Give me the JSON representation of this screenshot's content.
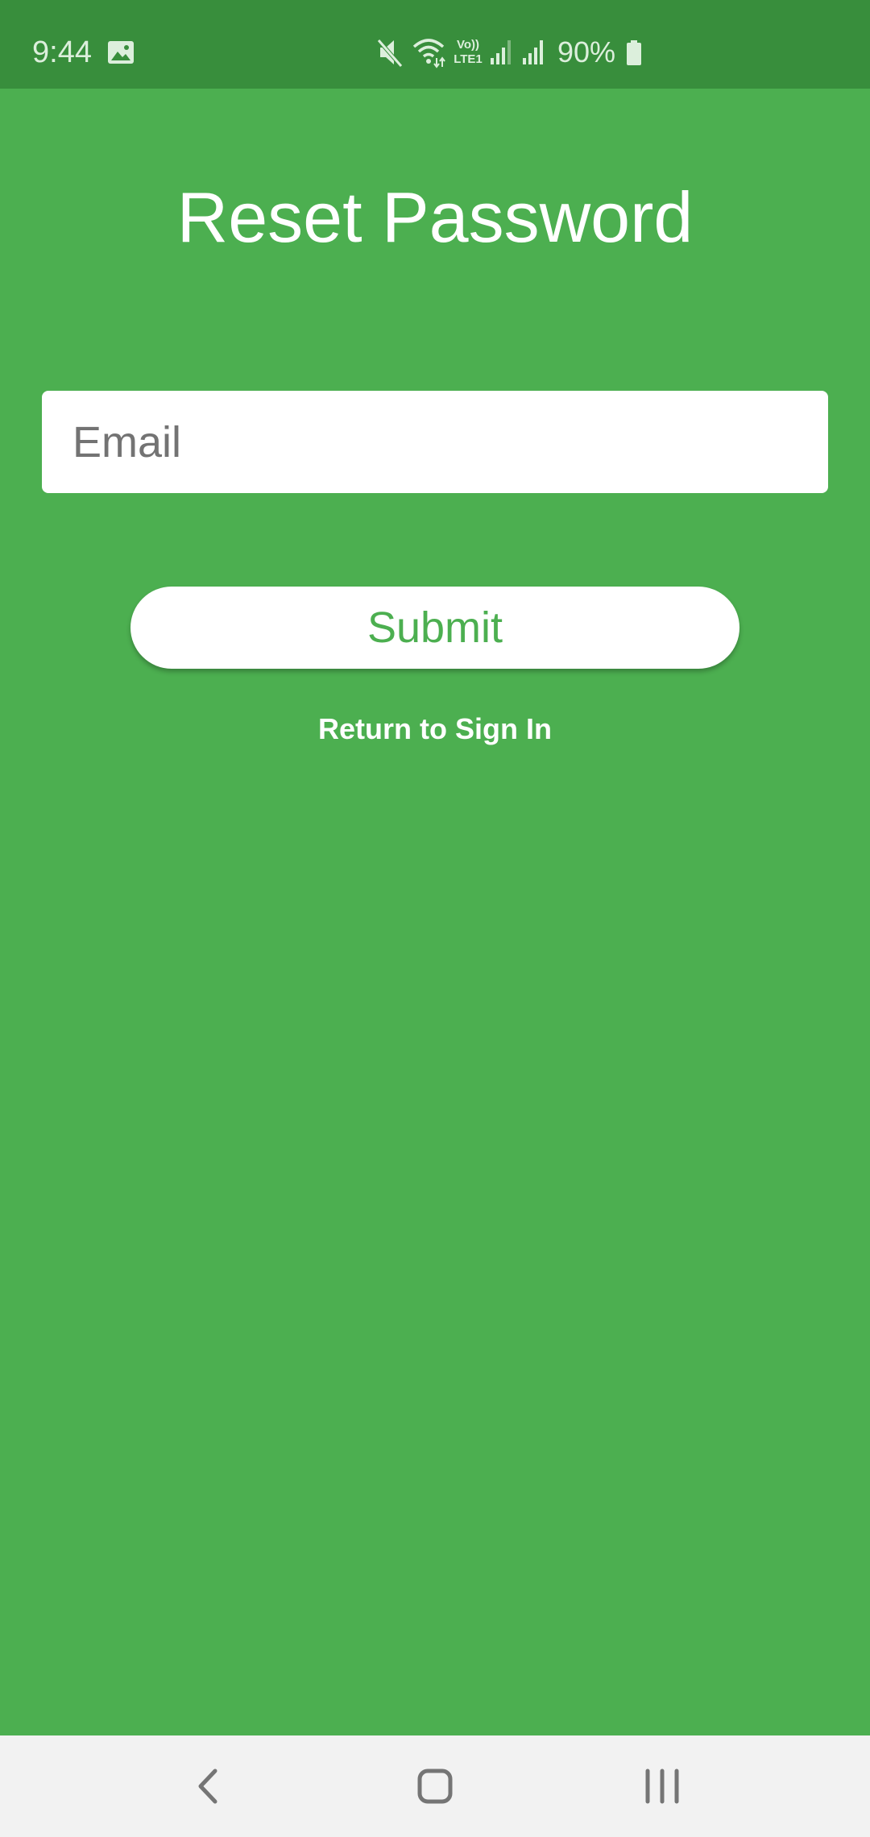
{
  "status_bar": {
    "time": "9:44",
    "battery_percent": "90%",
    "icons": [
      "image-icon",
      "mute-icon",
      "wifi-icon",
      "volte-lte-icon",
      "signal-icon",
      "signal-icon",
      "battery-icon"
    ]
  },
  "page": {
    "title": "Reset Password"
  },
  "form": {
    "email_placeholder": "Email",
    "email_value": "",
    "submit_label": "Submit",
    "return_link_label": "Return to Sign In"
  },
  "nav_bar": {
    "icons": [
      "back-icon",
      "home-icon",
      "recents-icon"
    ]
  },
  "colors": {
    "background": "#4caf50",
    "status_bar": "#388e3c",
    "accent_text": "#4caf50",
    "nav_bar": "#f2f2f2"
  }
}
